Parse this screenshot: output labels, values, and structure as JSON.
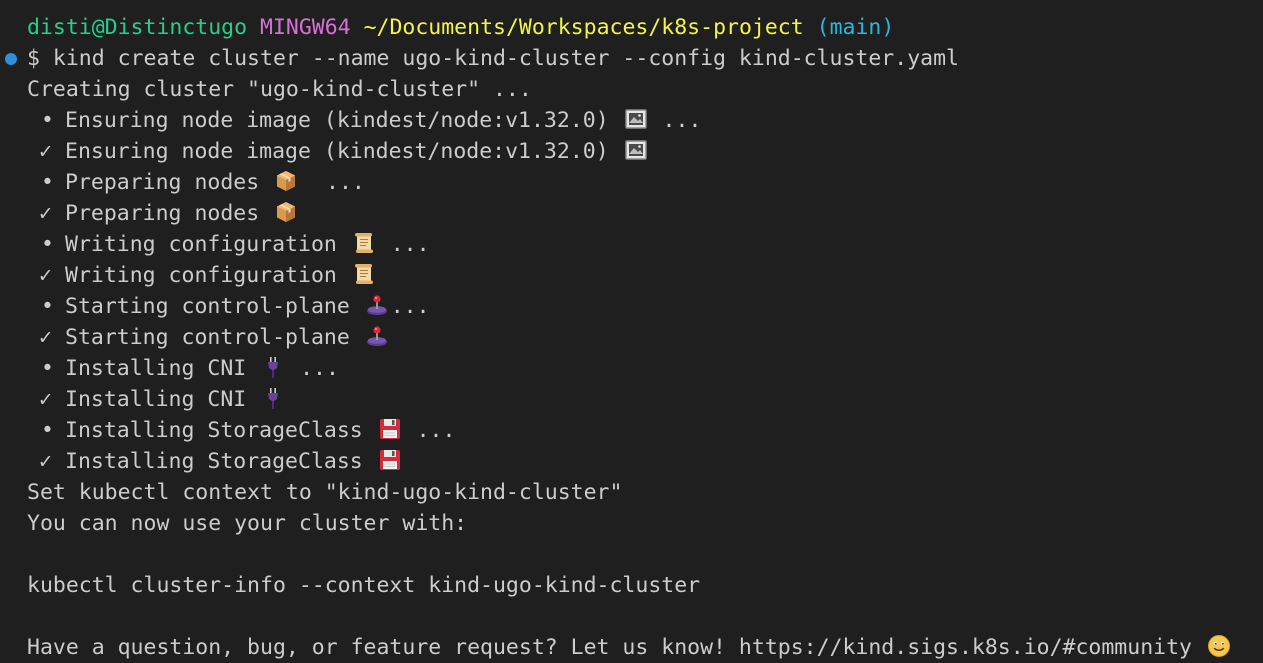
{
  "prompt": {
    "user_host": "disti@Distinctugo",
    "shell": "MINGW64",
    "path": "~/Documents/Workspaces/k8s-project",
    "branch": "(main)"
  },
  "command": "$ kind create cluster --name ugo-kind-cluster --config kind-cluster.yaml",
  "output": {
    "creating": "Creating cluster \"ugo-kind-cluster\" ...",
    "steps": [
      {
        "marker": "•",
        "text": "Ensuring node image (kindest/node:v1.32.0)",
        "icon": "framed-picture-icon",
        "suffix": " ..."
      },
      {
        "marker": "✓",
        "text": "Ensuring node image (kindest/node:v1.32.0)",
        "icon": "framed-picture-icon",
        "suffix": ""
      },
      {
        "marker": "•",
        "text": "Preparing nodes",
        "icon": "package-icon",
        "suffix": "  ..."
      },
      {
        "marker": "✓",
        "text": "Preparing nodes",
        "icon": "package-icon",
        "suffix": ""
      },
      {
        "marker": "•",
        "text": "Writing configuration",
        "icon": "scroll-icon",
        "suffix": " ..."
      },
      {
        "marker": "✓",
        "text": "Writing configuration",
        "icon": "scroll-icon",
        "suffix": ""
      },
      {
        "marker": "•",
        "text": "Starting control-plane",
        "icon": "joystick-icon",
        "suffix": "..."
      },
      {
        "marker": "✓",
        "text": "Starting control-plane",
        "icon": "joystick-icon",
        "suffix": ""
      },
      {
        "marker": "•",
        "text": "Installing CNI",
        "icon": "plug-icon",
        "suffix": " ..."
      },
      {
        "marker": "✓",
        "text": "Installing CNI",
        "icon": "plug-icon",
        "suffix": ""
      },
      {
        "marker": "•",
        "text": "Installing StorageClass",
        "icon": "floppy-disk-icon",
        "suffix": " ..."
      },
      {
        "marker": "✓",
        "text": "Installing StorageClass",
        "icon": "floppy-disk-icon",
        "suffix": ""
      }
    ],
    "set_context": "Set kubectl context to \"kind-ugo-kind-cluster\"",
    "usage_hint": "You can now use your cluster with:",
    "usage_command": "kubectl cluster-info --context kind-ugo-kind-cluster",
    "feedback": "Have a question, bug, or feature request? Let us know! https://kind.sigs.k8s.io/#community",
    "feedback_icon": "slightly-smiling-face-icon"
  },
  "colors": {
    "background": "#1f1f1f",
    "text": "#cccccc",
    "user_host": "#23d18b",
    "shell": "#d670d6",
    "path": "#f5f543",
    "branch": "#29b8db",
    "command_marker": "#2f8fd8"
  }
}
